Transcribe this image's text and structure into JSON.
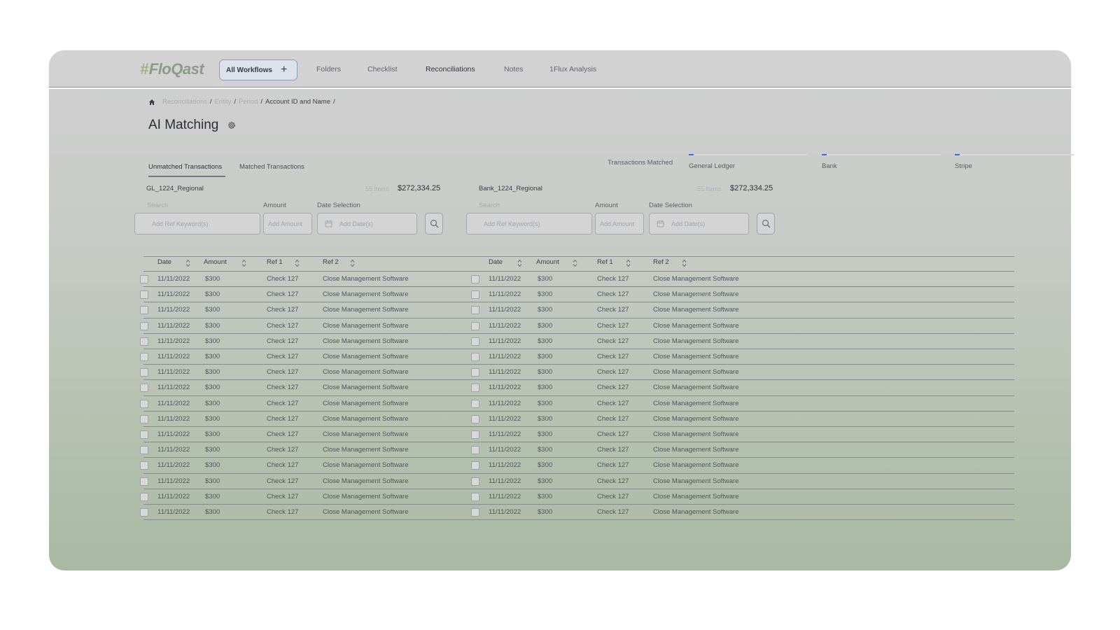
{
  "app": {
    "logo_text": "FloQast",
    "colors": {
      "accent": "#3d6fd8",
      "logo": "#9fb37b"
    }
  },
  "topnav": {
    "workflows_button": "All Workflows",
    "items": [
      "Folders",
      "Checklist",
      "Reconciliations",
      "Notes",
      "1Flux Analysis"
    ]
  },
  "breadcrumb": {
    "items": [
      "Reconciliations",
      "Entity",
      "Period",
      "Account ID and Name"
    ],
    "separator": "/"
  },
  "page": {
    "title": "AI Matching"
  },
  "tabs": [
    "Unmatched Transactions",
    "Matched Transactions"
  ],
  "matching": {
    "label": "Transactions Matched",
    "sources": [
      {
        "label": "General Ledger",
        "progress_pct": 3
      },
      {
        "label": "Bank",
        "progress_pct": 3
      },
      {
        "label": "Stripe",
        "progress_pct": 3
      }
    ]
  },
  "left": {
    "account": "GL_1224_Regional",
    "count": "55 Items",
    "total": "$272,334.25",
    "filters": {
      "search_label": "Search",
      "search_placeholder": "Add Ref Keyword(s)",
      "amount_label": "Amount",
      "amount_placeholder": "Add Amount",
      "date_label": "Date Selection",
      "date_placeholder": "Add Date(s)"
    },
    "columns": [
      "Date",
      "Amount",
      "Ref 1",
      "Ref 2"
    ],
    "rows": [
      [
        "11/11/2022",
        "$300",
        "Check 127",
        "Close Management Software"
      ],
      [
        "11/11/2022",
        "$300",
        "Check 127",
        "Close Management Software"
      ],
      [
        "11/11/2022",
        "$300",
        "Check 127",
        "Close Management Software"
      ],
      [
        "11/11/2022",
        "$300",
        "Check 127",
        "Close Management Software"
      ],
      [
        "11/11/2022",
        "$300",
        "Check 127",
        "Close Management Software"
      ],
      [
        "11/11/2022",
        "$300",
        "Check 127",
        "Close Management Software"
      ],
      [
        "11/11/2022",
        "$300",
        "Check 127",
        "Close Management Software"
      ],
      [
        "11/11/2022",
        "$300",
        "Check 127",
        "Close Management Software"
      ],
      [
        "11/11/2022",
        "$300",
        "Check 127",
        "Close Management Software"
      ],
      [
        "11/11/2022",
        "$300",
        "Check 127",
        "Close Management Software"
      ],
      [
        "11/11/2022",
        "$300",
        "Check 127",
        "Close Management Software"
      ],
      [
        "11/11/2022",
        "$300",
        "Check 127",
        "Close Management Software"
      ],
      [
        "11/11/2022",
        "$300",
        "Check 127",
        "Close Management Software"
      ],
      [
        "11/11/2022",
        "$300",
        "Check 127",
        "Close Management Software"
      ],
      [
        "11/11/2022",
        "$300",
        "Check 127",
        "Close Management Software"
      ],
      [
        "11/11/2022",
        "$300",
        "Check 127",
        "Close Management Software"
      ]
    ]
  },
  "right": {
    "account": "Bank_1224_Regional",
    "count": "55 Items",
    "total": "$272,334.25",
    "filters": {
      "search_label": "Search",
      "search_placeholder": "Add Ref Keyword(s)",
      "amount_label": "Amount",
      "amount_placeholder": "Add Amount",
      "date_label": "Date Selection",
      "date_placeholder": "Add Date(s)"
    },
    "columns": [
      "Date",
      "Amount",
      "Ref 1",
      "Ref 2"
    ],
    "rows": [
      [
        "11/11/2022",
        "$300",
        "Check 127",
        "Close Management Software"
      ],
      [
        "11/11/2022",
        "$300",
        "Check 127",
        "Close Management Software"
      ],
      [
        "11/11/2022",
        "$300",
        "Check 127",
        "Close Management Software"
      ],
      [
        "11/11/2022",
        "$300",
        "Check 127",
        "Close Management Software"
      ],
      [
        "11/11/2022",
        "$300",
        "Check 127",
        "Close Management Software"
      ],
      [
        "11/11/2022",
        "$300",
        "Check 127",
        "Close Management Software"
      ],
      [
        "11/11/2022",
        "$300",
        "Check 127",
        "Close Management Software"
      ],
      [
        "11/11/2022",
        "$300",
        "Check 127",
        "Close Management Software"
      ],
      [
        "11/11/2022",
        "$300",
        "Check 127",
        "Close Management Software"
      ],
      [
        "11/11/2022",
        "$300",
        "Check 127",
        "Close Management Software"
      ],
      [
        "11/11/2022",
        "$300",
        "Check 127",
        "Close Management Software"
      ],
      [
        "11/11/2022",
        "$300",
        "Check 127",
        "Close Management Software"
      ],
      [
        "11/11/2022",
        "$300",
        "Check 127",
        "Close Management Software"
      ],
      [
        "11/11/2022",
        "$300",
        "Check 127",
        "Close Management Software"
      ],
      [
        "11/11/2022",
        "$300",
        "Check 127",
        "Close Management Software"
      ],
      [
        "11/11/2022",
        "$300",
        "Check 127",
        "Close Management Software"
      ]
    ]
  }
}
